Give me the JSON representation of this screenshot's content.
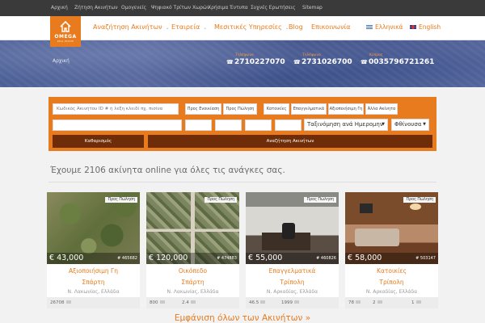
{
  "topbar": {
    "links": [
      "Αρχική",
      "Ζήτηση Ακινήτων",
      "Ομογενείς",
      "Ψηφιακό Τρίτων Χωρών",
      "Χρήσιμα Έντυπα",
      "Συχνές Ερωτήσεις",
      "Sitemap"
    ]
  },
  "logo": {
    "name": "OMEGA",
    "sub": "REAL ESTATE"
  },
  "nav": {
    "items": [
      {
        "label": "Αναζήτηση Ακινήτων",
        "has_dropdown": true
      },
      {
        "label": "Εταιρεία",
        "has_dropdown": true
      },
      {
        "label": "Μεσιτικές Υπηρεσίες",
        "has_dropdown": true
      },
      {
        "label": "Blog",
        "has_dropdown": false
      },
      {
        "label": "Επικοινωνία",
        "has_dropdown": false
      }
    ],
    "languages": [
      "Ελληνικά",
      "English"
    ]
  },
  "hero": {
    "breadcrumb": "Αρχική",
    "phones": [
      {
        "label": "Τηλέφωνο",
        "number": "2710227070"
      },
      {
        "label": "Τηλέφωνο",
        "number": "2731026700"
      },
      {
        "label": "Κύπρος",
        "number": "0035796721261"
      }
    ]
  },
  "search": {
    "keyword_placeholder": "Κωδικός Ακινήτου ID # ή λέξη κλειδί πχ. πισίνα",
    "rent_label": "Προς Ενοικίαση",
    "sale_label": "Προς Πώληση",
    "categories": [
      "Κατοικίες",
      "Επαγγελματικά",
      "Αξιοποιήσιμη Γη",
      "Άλλα Ακίνητα"
    ],
    "sort_value": "Ταξινόμηση ανά Ημερομην",
    "order_value": "Φθίνουσα",
    "clear_label": "Καθαρισμός",
    "submit_label": "Αναζήτηση Ακινήτων"
  },
  "headline": "Έχουμε 2106 ακίνητα online για όλες τις ανάγκες σας.",
  "listings": [
    {
      "tag": "Προς Πώληση",
      "price": "€ 43,000",
      "code": "# 465682",
      "title": "Αξιοποιήσιμη Γη",
      "city": "Σπάρτη",
      "region": "Ν. Λακωνίας, Ελλάδα",
      "stats": [
        "26708"
      ]
    },
    {
      "tag": "Προς Πώληση",
      "price": "€ 120,000",
      "code": "# 474883",
      "title": "Οικόπεδο",
      "city": "Σπάρτη",
      "region": "Ν. Λακωνίας, Ελλάδα",
      "stats": [
        "800",
        "2.4"
      ]
    },
    {
      "tag": "Προς Πώληση",
      "price": "€ 55,000",
      "code": "# 460826",
      "title": "Επαγγελματικά",
      "city": "Τρίπολη",
      "region": "Ν. Αρκαδίας, Ελλάδα",
      "stats": [
        "46.5",
        "1999"
      ]
    },
    {
      "tag": "Προς Πώληση",
      "price": "€ 58,000",
      "code": "# 503147",
      "title": "Κατοικίες",
      "city": "Τρίπολη",
      "region": "Ν. Αρκαδίας, Ελλάδα",
      "stats": [
        "78",
        "2",
        "1"
      ]
    }
  ],
  "show_all": "Εμφάνιση όλων των Ακινήτων »",
  "colors": {
    "accent": "#e87b1e",
    "dark_button": "#6e2c08",
    "topbar": "#3a3a3a"
  }
}
